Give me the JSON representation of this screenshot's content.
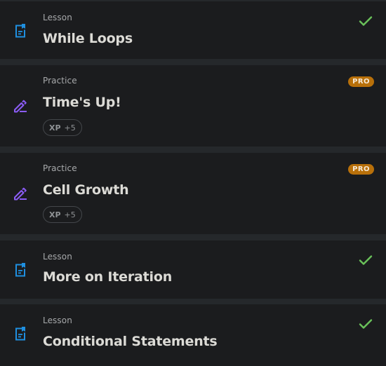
{
  "items": [
    {
      "kind": "Lesson",
      "title": "While Loops",
      "icon": "lesson-doc-icon",
      "completed": true
    },
    {
      "kind": "Practice",
      "title": "Time's Up!",
      "icon": "practice-pen-icon",
      "badge": "PRO",
      "xp_label": "XP",
      "xp_value": "+5"
    },
    {
      "kind": "Practice",
      "title": "Cell Growth",
      "icon": "practice-pen-icon",
      "badge": "PRO",
      "xp_label": "XP",
      "xp_value": "+5"
    },
    {
      "kind": "Lesson",
      "title": "More on Iteration",
      "icon": "lesson-doc-icon",
      "completed": true
    },
    {
      "kind": "Lesson",
      "title": "Conditional Statements",
      "icon": "lesson-doc-icon",
      "completed": true
    }
  ],
  "colors": {
    "lesson_icon": "#1f8fe0",
    "practice_icon": "#8b5cf6",
    "check": "#6ac25a",
    "pro_badge": "#b8700a"
  }
}
